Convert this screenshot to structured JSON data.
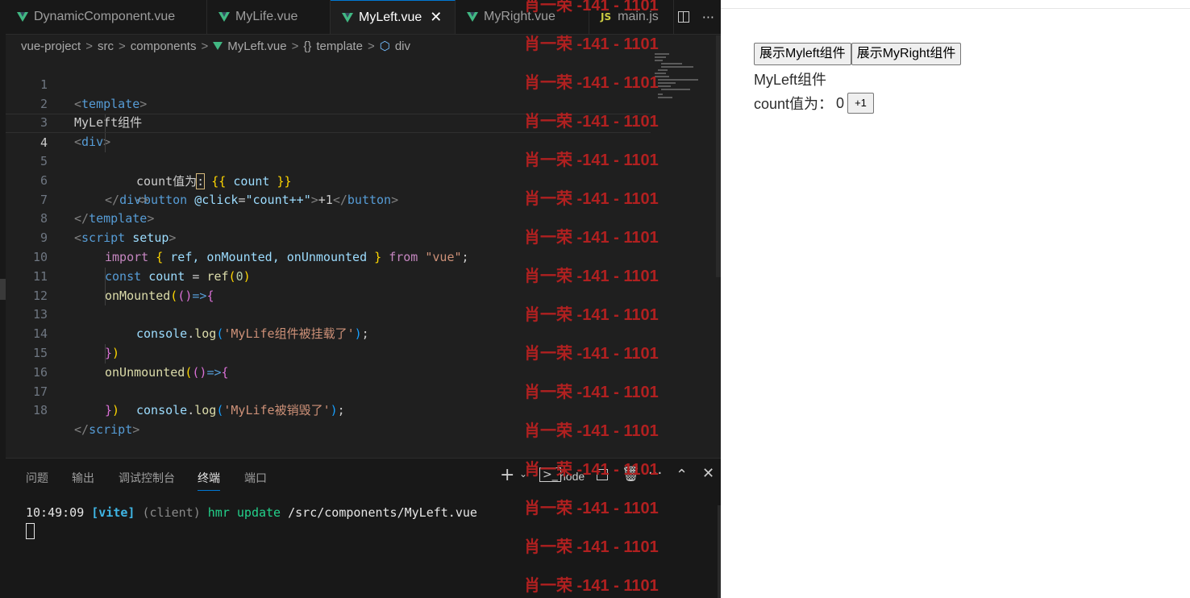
{
  "tabs": [
    {
      "label": "DynamicComponent.vue",
      "icon": "vue"
    },
    {
      "label": "MyLife.vue",
      "icon": "vue"
    },
    {
      "label": "MyLeft.vue",
      "icon": "vue",
      "active": true
    },
    {
      "label": "MyRight.vue",
      "icon": "vue"
    },
    {
      "label": "main.js",
      "icon": "JS"
    }
  ],
  "tab_close": "✕",
  "tab_more": "···",
  "breadcrumb": [
    "vue-project",
    "src",
    "components",
    "MyLeft.vue",
    "template",
    "div"
  ],
  "breadcrumb_template_icon": "{}",
  "breadcrumb_sep": ">",
  "code_lines": [
    {
      "n": "1"
    },
    {
      "n": "2"
    },
    {
      "n": "3"
    },
    {
      "n": "4",
      "active": true
    },
    {
      "n": "5"
    },
    {
      "n": "6"
    },
    {
      "n": "7"
    },
    {
      "n": "8"
    },
    {
      "n": "9"
    },
    {
      "n": "10"
    },
    {
      "n": "11"
    },
    {
      "n": "12"
    },
    {
      "n": "13"
    },
    {
      "n": "14"
    },
    {
      "n": "15"
    },
    {
      "n": "16"
    },
    {
      "n": "17"
    },
    {
      "n": "18"
    }
  ],
  "code": {
    "l1_tag": "template",
    "l2_text": "MyLeft组件",
    "l3_tag": "div",
    "l4_text": "count值为",
    "l4_colon": ":",
    "l4_var": "count",
    "l5_tag": "button",
    "l5_attr": "@click",
    "l5_val": "\"count++\"",
    "l5_text": "+1",
    "l6_tag": "div",
    "l7_tag": "template",
    "l8_tag": "script",
    "l8_attr": "setup",
    "l9_import": "import",
    "l9_names": "ref, onMounted, onUnmounted",
    "l9_from": "from",
    "l9_mod": "\"vue\"",
    "l10_const": "const",
    "l10_var": "count",
    "l10_fn": "ref",
    "l10_num": "0",
    "l11_fn": "onMounted",
    "l12_obj": "console",
    "l12_fn": "log",
    "l12_str": "'MyLife组件被挂载了'",
    "l15_fn": "onUnmounted",
    "l16_obj": "console",
    "l16_fn": "log",
    "l16_str": "'MyLife被销毁了'",
    "l18_tag": "script"
  },
  "panel": {
    "tabs": [
      "问题",
      "输出",
      "调试控制台",
      "终端",
      "端口"
    ],
    "active_tab": "终端",
    "terminal_name": "node",
    "terminal": {
      "time": "10:49:09",
      "tag": "[vite]",
      "client": "(client)",
      "hmr": "hmr update",
      "path": "/src/components/MyLeft.vue"
    }
  },
  "watermark": "肖一荣 -141 - 1101",
  "preview": {
    "button_left": "展示Myleft组件",
    "button_right": "展示MyRight组件",
    "component_title": "MyLeft组件",
    "count_label": "count值为：",
    "count_value": "0",
    "increment_label": "+1"
  },
  "colors": {
    "editor_bg": "#1f1f1f",
    "accent": "#0078d4",
    "vue_green": "#41b883",
    "watermark": "#b02020"
  }
}
